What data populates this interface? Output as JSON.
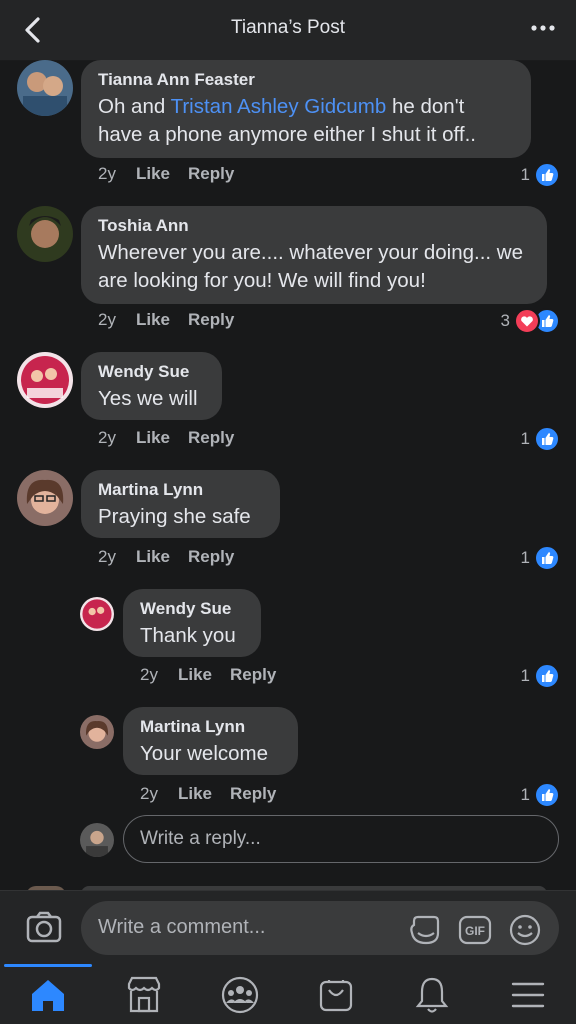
{
  "header": {
    "title": "Tianna’s Post"
  },
  "comments": [
    {
      "author": "Tianna Ann Feaster",
      "text_before": "Oh and ",
      "mention": "Tristan Ashley Gidcumb",
      "text_after": " he don't have a phone anymore either I shut it off..",
      "age": "2y",
      "like": "Like",
      "reply": "Reply",
      "count": "1",
      "reactions": [
        "like"
      ]
    },
    {
      "author": "Toshia Ann",
      "text": "Wherever you are.... whatever your doing... we are looking for you! We will find you!",
      "age": "2y",
      "like": "Like",
      "reply": "Reply",
      "count": "3",
      "reactions": [
        "love",
        "like"
      ]
    },
    {
      "author": "Wendy Sue",
      "text": "Yes we will",
      "age": "2y",
      "like": "Like",
      "reply": "Reply",
      "count": "1",
      "reactions": [
        "like"
      ]
    },
    {
      "author": "Martina Lynn",
      "text": "Praying she safe",
      "age": "2y",
      "like": "Like",
      "reply": "Reply",
      "count": "1",
      "reactions": [
        "like"
      ]
    },
    {
      "author": "Wendy Sue",
      "text": "Thank you",
      "age": "2y",
      "like": "Like",
      "reply": "Reply",
      "count": "1",
      "reactions": [
        "like"
      ]
    },
    {
      "author": "Martina Lynn",
      "text": "Your welcome",
      "age": "2y",
      "like": "Like",
      "reply": "Reply",
      "count": "1",
      "reactions": [
        "like"
      ]
    }
  ],
  "reply_box": {
    "placeholder": "Write a reply..."
  },
  "composer": {
    "placeholder": "Write a comment..."
  },
  "colors": {
    "background": "#18191a",
    "bubble": "#3a3b3c",
    "accent": "#2d88ff",
    "love": "#f33e58",
    "mention": "#4d91f5"
  },
  "tabbar": {
    "items": [
      "home-icon",
      "marketplace-icon",
      "groups-icon",
      "shop-icon",
      "notifications-icon",
      "menu-icon"
    ],
    "active": "home-icon"
  }
}
